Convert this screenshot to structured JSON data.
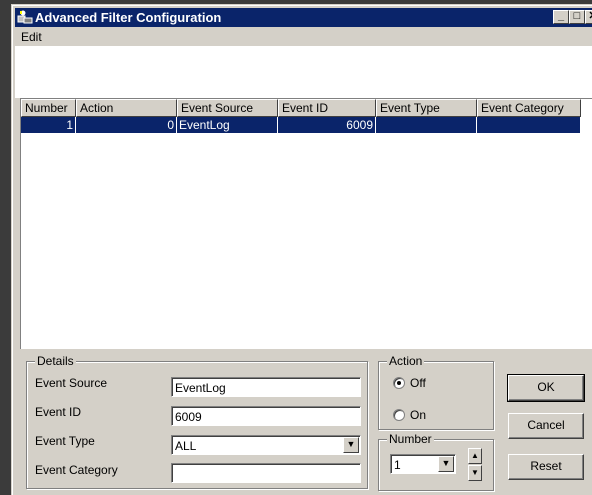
{
  "window": {
    "title": "Advanced Filter Configuration"
  },
  "titlebar_buttons": {
    "minimize": "_",
    "maximize": "□",
    "close": "✕"
  },
  "menubar": {
    "edit": "Edit"
  },
  "list": {
    "columns": [
      "Number",
      "Action",
      "Event Source",
      "Event ID",
      "Event Type",
      "Event Category"
    ],
    "rows": [
      {
        "number": "1",
        "action": "0",
        "event_source": "EventLog",
        "event_id": "6009",
        "event_type": "",
        "event_category": ""
      }
    ]
  },
  "details": {
    "group_label": "Details",
    "event_source_label": "Event Source",
    "event_source_value": "EventLog",
    "event_id_label": "Event ID",
    "event_id_value": "6009",
    "event_type_label": "Event Type",
    "event_type_value": "ALL",
    "event_category_label": "Event Category",
    "event_category_value": ""
  },
  "action": {
    "group_label": "Action",
    "off_label": "Off",
    "on_label": "On",
    "selected": "Off"
  },
  "number": {
    "group_label": "Number",
    "value": "1"
  },
  "buttons": {
    "ok": "OK",
    "cancel": "Cancel",
    "reset": "Reset"
  },
  "colors": {
    "titlebar": "#0a246a",
    "selection": "#0a246a",
    "face": "#d4d0c8",
    "desktop": "#3b3b3b"
  },
  "icons": {
    "app": "filter-app-icon",
    "combo": "chevron-down-icon",
    "spin_up": "arrow-up-icon",
    "spin_down": "arrow-down-icon"
  }
}
